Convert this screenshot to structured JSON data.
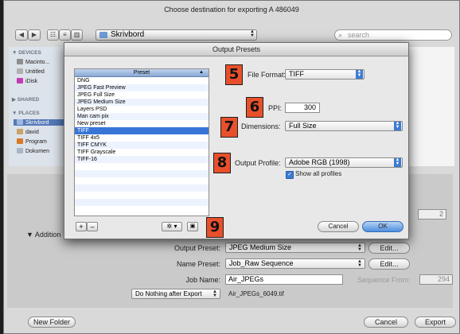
{
  "export_sheet": {
    "title": "Choose destination for exporting A 486049",
    "location": "Skrivbord",
    "search_placeholder": "search",
    "nav_back": "◀",
    "nav_forward": "▶",
    "view_icons": "☷",
    "view_list": "≡",
    "view_columns": "▥"
  },
  "sidebar": {
    "devices_header": "▼ DEVICES",
    "devices": [
      "Macinto...",
      "Untitled",
      "iDisk"
    ],
    "shared_header": "▶ SHARED",
    "places_header": "▼ PLACES",
    "places": [
      "Skrivbord",
      "david",
      "Program",
      "Dokumen"
    ]
  },
  "lower": {
    "additional_label": "▼  Addition",
    "output_preset_label": "Output Preset:",
    "output_preset_value": "JPEG Medium Size",
    "name_preset_label": "Name Preset:",
    "name_preset_value": "Job_Raw Sequence",
    "edit_label": "Edit...",
    "job_name_label": "Job Name:",
    "job_name_value": "Air_JPEGs",
    "sequence_from_label": "Sequence From:",
    "sequence_from_value": "294",
    "after_export_value": "Do Nothing after Export",
    "filename_preview": "Air_JPEGs_6049.tif",
    "right_value": "2",
    "new_folder_label": "New Folder",
    "cancel_label": "Cancel",
    "export_label": "Export"
  },
  "dialog": {
    "title": "Output Presets",
    "preset_header": "Preset",
    "presets": [
      "DNG",
      "JPEG Fast Preview",
      "JPEG Full Size",
      "JPEG Medium Size",
      "Layers PSD",
      "Man cam pix",
      "New preset",
      "TIFF",
      "TIFF 4x5",
      "TIFF CMYK",
      "TIFF Grayscale",
      "TIFF-16"
    ],
    "selected_preset": "TIFF",
    "file_format_label": "File Format:",
    "file_format_value": "TIFF",
    "ppi_label": "PPI:",
    "ppi_value": "300",
    "dimensions_label": "Dimensions:",
    "dimensions_value": "Full Size",
    "output_profile_label": "Output Profile:",
    "output_profile_value": "Adobe RGB (1998)",
    "show_all_profiles_label": "Show all profiles",
    "add_label": "+",
    "remove_label": "–",
    "gear_label": "✲ ▾",
    "lock_label": "🔒",
    "cancel_label": "Cancel",
    "ok_label": "OK",
    "callouts": [
      "5",
      "6",
      "7",
      "8",
      "9"
    ]
  },
  "colors": {
    "callout_fill": "#e8502b",
    "selection_blue": "#3875d7",
    "ok_button": "#6ea6e8"
  }
}
